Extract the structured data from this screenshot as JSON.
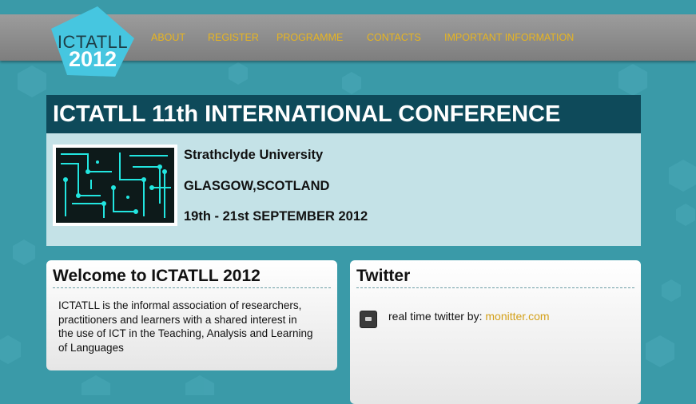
{
  "header": {
    "logo": {
      "line1": "ICTATLL",
      "line2": "2012"
    },
    "nav": [
      "ABOUT",
      "REGISTER",
      "PROGRAMME",
      "CONTACTS",
      "IMPORTANT INFORMATION"
    ]
  },
  "hero": {
    "title": "ICTATLL 11th INTERNATIONAL CONFERENCE",
    "venue": "Strathclyde University",
    "location": "GLASGOW,SCOTLAND",
    "dates": "19th - 21st SEPTEMBER 2012"
  },
  "welcome": {
    "title": "Welcome to ICTATLL 2012",
    "body": "ICTATLL is the informal association of researchers, practitioners and learners with a shared interest in the use of ICT in the Teaching, Analysis and Learning of Languages"
  },
  "twitter": {
    "title": "Twitter",
    "text": "real time twitter by: ",
    "link": "monitter.com"
  },
  "colors": {
    "background": "#3a9aa8",
    "nav_text": "#e8b520",
    "hero_title_bg": "#0e4a5a",
    "hero_body_bg": "#c4e2e7",
    "logo_hexagon": "#46c6e0",
    "link": "#d4a11a"
  }
}
